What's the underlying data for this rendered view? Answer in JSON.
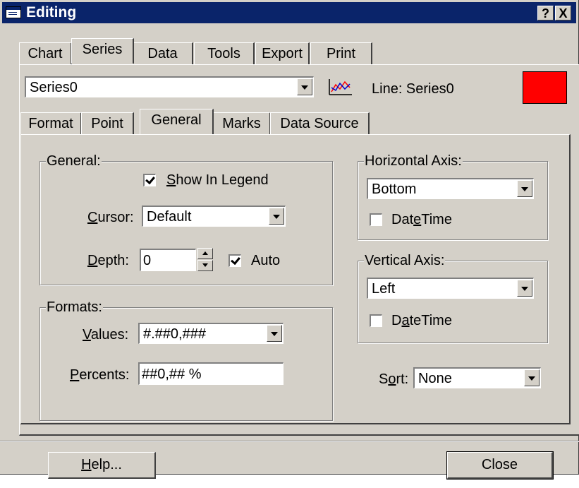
{
  "window": {
    "title": "Editing",
    "help_glyph": "?",
    "close_glyph": "X"
  },
  "main_tabs": [
    {
      "label": "Chart"
    },
    {
      "label": "Series",
      "active": true
    },
    {
      "label": "Data"
    },
    {
      "label": "Tools"
    },
    {
      "label": "Export"
    },
    {
      "label": "Print"
    }
  ],
  "series_selector": {
    "value": "Series0",
    "series_type_label": "Line: Series0",
    "series_icon": "line-chart-icon",
    "series_color": "#ff0000"
  },
  "sub_tabs": [
    {
      "label": "Format"
    },
    {
      "label": "Point"
    },
    {
      "label": "General",
      "active": true
    },
    {
      "label": "Marks"
    },
    {
      "label": "Data Source"
    }
  ],
  "general_group": {
    "title": "General:",
    "show_in_legend": {
      "pre": "",
      "accel": "S",
      "post": "how In Legend",
      "checked": true
    },
    "cursor": {
      "accel": "C",
      "post": "ursor:",
      "value": "Default"
    },
    "depth": {
      "accel": "D",
      "post": "epth:",
      "value": "0"
    },
    "auto": {
      "label": "Auto",
      "checked": true
    }
  },
  "formats_group": {
    "title": "Formats:",
    "values": {
      "accel": "V",
      "post": "alues:",
      "value": "#.##0,###"
    },
    "percents": {
      "accel": "P",
      "post": "ercents:",
      "value": "##0,## %"
    }
  },
  "horizontal_axis": {
    "title": "Horizontal Axis:",
    "value": "Bottom",
    "datetime": {
      "pre": "Dat",
      "accel": "e",
      "post": "Time",
      "checked": false
    }
  },
  "vertical_axis": {
    "title": "Vertical Axis:",
    "value": "Left",
    "datetime": {
      "pre": "D",
      "accel": "a",
      "post": "teTime",
      "checked": false
    }
  },
  "sort": {
    "pre": "S",
    "accel": "o",
    "post": "rt:",
    "value": "None"
  },
  "buttons": {
    "help": {
      "accel": "H",
      "post": "elp..."
    },
    "close": "Close"
  }
}
